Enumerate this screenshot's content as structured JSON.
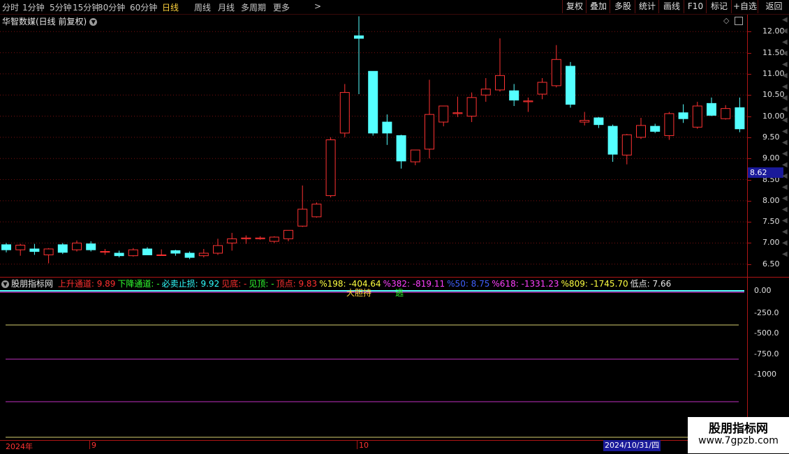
{
  "toolbar": {
    "timeframes": [
      "分时",
      "1分钟",
      "5分钟",
      "15分钟",
      "30分钟",
      "60分钟",
      "日线",
      "周线",
      "月线",
      "多周期",
      "更多"
    ],
    "active_timeframe": "日线",
    "right_buttons": [
      "复权",
      "叠加",
      "多股",
      "统计",
      "画线",
      "F10",
      "标记",
      "+自选",
      "返回"
    ]
  },
  "stock": {
    "title": "华智数媒(日线 前复权)"
  },
  "price_tag": "8.62",
  "price_axis": {
    "ticks": [
      "12.00",
      "11.50",
      "11.00",
      "10.50",
      "10.00",
      "9.50",
      "9.00",
      "8.50",
      "8.00",
      "7.50",
      "7.00",
      "6.50"
    ]
  },
  "indicator": {
    "name": "股朋指标网",
    "items": [
      {
        "text": "上升通道: 9.89",
        "color": "#ff3030"
      },
      {
        "text": "下降通道: -",
        "color": "#30ff30"
      },
      {
        "text": "必卖止损: 9.92",
        "color": "#30ffff"
      },
      {
        "text": "见底: -",
        "color": "#ff3030"
      },
      {
        "text": "见顶: -",
        "color": "#30ff30"
      },
      {
        "text": "顶点: 9.83",
        "color": "#ff3030"
      },
      {
        "text": "%198: -404.64",
        "color": "#ffff40"
      },
      {
        "text": "%382: -819.11",
        "color": "#ff40ff"
      },
      {
        "text": "%50: 8.75",
        "color": "#4060ff"
      },
      {
        "text": "%618: -1331.23",
        "color": "#ff40ff"
      },
      {
        "text": "%809: -1745.70",
        "color": "#ffff40"
      },
      {
        "text": "低点: 7.66",
        "color": "#e8e8e8"
      }
    ],
    "axis_ticks": [
      "0.00",
      "-250.0",
      "-500.0",
      "-750.0",
      "-1000"
    ],
    "marker_labels": [
      "大胆持",
      "逃"
    ],
    "line_colors": [
      "#d8d070",
      "#c030c0",
      "#c030c0",
      "#d8d070"
    ]
  },
  "date_axis": {
    "labels": [
      "2024年",
      "9",
      "10"
    ],
    "cursor_date": "2024/10/31/四"
  },
  "watermark": {
    "title": "股朋指标网",
    "url": "www.7gpzb.com"
  },
  "colors": {
    "up": "#ff3232",
    "down": "#54ffff",
    "doji": "#ffffff",
    "grid": "#7a1010"
  },
  "chart_data": {
    "type": "candlestick",
    "ylim": [
      6.2,
      12.4
    ],
    "candles": [
      {
        "o": 6.96,
        "h": 7.0,
        "l": 6.78,
        "c": 6.84
      },
      {
        "o": 6.84,
        "h": 6.98,
        "l": 6.7,
        "c": 6.95
      },
      {
        "o": 6.86,
        "h": 6.98,
        "l": 6.72,
        "c": 6.8
      },
      {
        "o": 6.72,
        "h": 6.88,
        "l": 6.52,
        "c": 6.86
      },
      {
        "o": 6.96,
        "h": 7.0,
        "l": 6.74,
        "c": 6.78
      },
      {
        "o": 6.84,
        "h": 7.06,
        "l": 6.8,
        "c": 7.0
      },
      {
        "o": 6.98,
        "h": 7.04,
        "l": 6.8,
        "c": 6.84
      },
      {
        "o": 6.8,
        "h": 6.86,
        "l": 6.72,
        "c": 6.8
      },
      {
        "o": 6.76,
        "h": 6.82,
        "l": 6.66,
        "c": 6.7
      },
      {
        "o": 6.7,
        "h": 6.88,
        "l": 6.68,
        "c": 6.84
      },
      {
        "o": 6.86,
        "h": 6.9,
        "l": 6.72,
        "c": 6.72
      },
      {
        "o": 6.71,
        "h": 6.85,
        "l": 6.7,
        "c": 6.72
      },
      {
        "o": 6.82,
        "h": 6.84,
        "l": 6.7,
        "c": 6.76
      },
      {
        "o": 6.76,
        "h": 6.8,
        "l": 6.62,
        "c": 6.66
      },
      {
        "o": 6.7,
        "h": 6.86,
        "l": 6.66,
        "c": 6.76
      },
      {
        "o": 6.76,
        "h": 7.1,
        "l": 6.72,
        "c": 6.94
      },
      {
        "o": 7.0,
        "h": 7.24,
        "l": 6.82,
        "c": 7.1
      },
      {
        "o": 7.1,
        "h": 7.18,
        "l": 6.98,
        "c": 7.12
      },
      {
        "o": 7.1,
        "h": 7.16,
        "l": 7.08,
        "c": 7.12
      },
      {
        "o": 7.04,
        "h": 7.16,
        "l": 7.0,
        "c": 7.14
      },
      {
        "o": 7.1,
        "h": 7.22,
        "l": 7.04,
        "c": 7.3
      },
      {
        "o": 7.4,
        "h": 8.36,
        "l": 7.38,
        "c": 7.8
      },
      {
        "o": 7.62,
        "h": 7.96,
        "l": 7.6,
        "c": 7.92
      },
      {
        "o": 8.12,
        "h": 9.5,
        "l": 8.08,
        "c": 9.44
      },
      {
        "o": 9.6,
        "h": 10.76,
        "l": 9.5,
        "c": 10.56
      },
      {
        "o": 11.9,
        "h": 12.36,
        "l": 10.52,
        "c": 11.84
      },
      {
        "o": 11.06,
        "h": 11.06,
        "l": 9.54,
        "c": 9.6
      },
      {
        "o": 9.86,
        "h": 10.04,
        "l": 9.32,
        "c": 9.6
      },
      {
        "o": 9.54,
        "h": 9.56,
        "l": 8.76,
        "c": 8.94
      },
      {
        "o": 8.92,
        "h": 9.2,
        "l": 8.84,
        "c": 9.2
      },
      {
        "o": 9.22,
        "h": 10.86,
        "l": 9.0,
        "c": 10.04
      },
      {
        "o": 9.86,
        "h": 10.22,
        "l": 9.76,
        "c": 10.24
      },
      {
        "o": 10.06,
        "h": 10.46,
        "l": 9.98,
        "c": 10.08
      },
      {
        "o": 10.0,
        "h": 10.56,
        "l": 9.86,
        "c": 10.44
      },
      {
        "o": 10.5,
        "h": 10.9,
        "l": 10.34,
        "c": 10.64
      },
      {
        "o": 10.62,
        "h": 11.84,
        "l": 10.58,
        "c": 10.96
      },
      {
        "o": 10.6,
        "h": 10.76,
        "l": 10.24,
        "c": 10.38
      },
      {
        "o": 10.34,
        "h": 10.44,
        "l": 10.1,
        "c": 10.36
      },
      {
        "o": 10.52,
        "h": 10.9,
        "l": 10.4,
        "c": 10.8
      },
      {
        "o": 10.72,
        "h": 11.68,
        "l": 10.68,
        "c": 11.34
      },
      {
        "o": 11.18,
        "h": 11.28,
        "l": 10.2,
        "c": 10.28
      },
      {
        "o": 9.86,
        "h": 10.1,
        "l": 9.78,
        "c": 9.9
      },
      {
        "o": 9.96,
        "h": 9.98,
        "l": 9.72,
        "c": 9.8
      },
      {
        "o": 9.76,
        "h": 9.8,
        "l": 8.92,
        "c": 9.1
      },
      {
        "o": 9.08,
        "h": 9.58,
        "l": 8.86,
        "c": 9.56
      },
      {
        "o": 9.5,
        "h": 9.96,
        "l": 9.46,
        "c": 9.78
      },
      {
        "o": 9.76,
        "h": 9.82,
        "l": 9.6,
        "c": 9.64
      },
      {
        "o": 9.54,
        "h": 10.1,
        "l": 9.44,
        "c": 10.06
      },
      {
        "o": 10.08,
        "h": 10.28,
        "l": 9.84,
        "c": 9.94
      },
      {
        "o": 9.74,
        "h": 10.34,
        "l": 9.7,
        "c": 10.24
      },
      {
        "o": 10.3,
        "h": 10.44,
        "l": 10.0,
        "c": 10.02
      },
      {
        "o": 9.94,
        "h": 10.26,
        "l": 9.92,
        "c": 10.18
      },
      {
        "o": 10.2,
        "h": 10.44,
        "l": 9.62,
        "c": 9.7
      }
    ]
  }
}
